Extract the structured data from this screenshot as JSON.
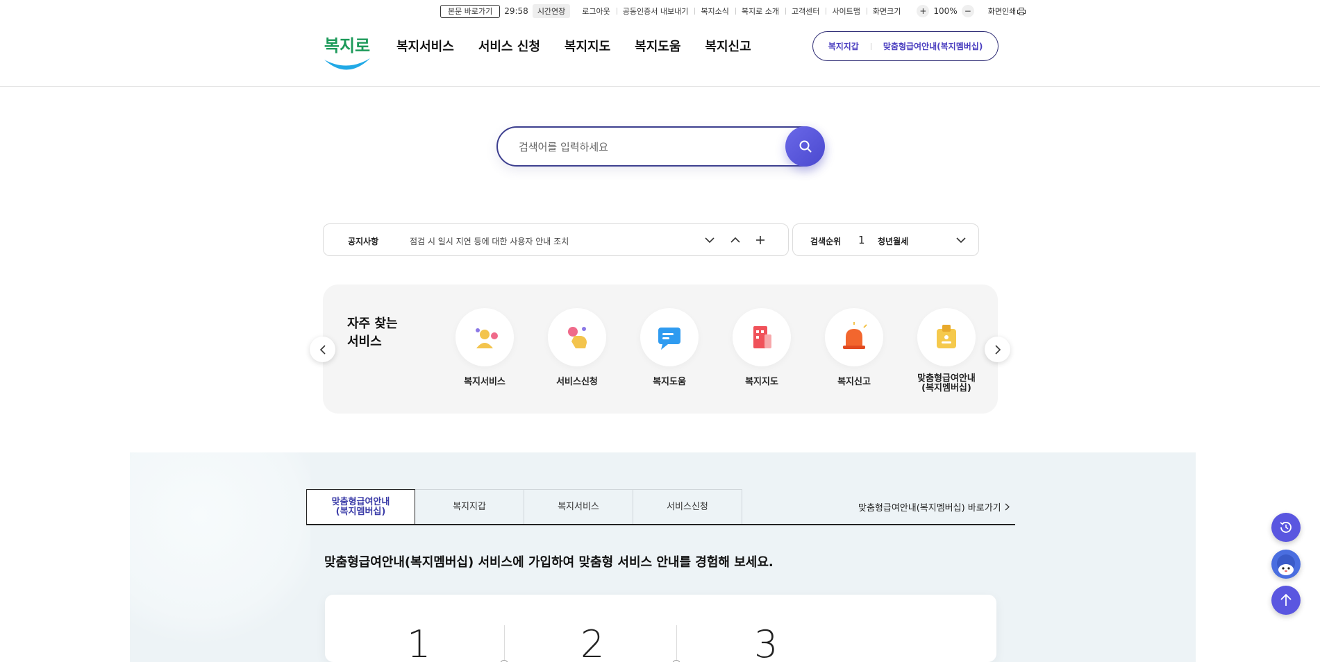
{
  "utility": {
    "skip_label": "본문 바로가기",
    "timer": "29:58",
    "extend_label": "시간연장",
    "links": [
      "로그아웃",
      "공동인증서 내보내기",
      "복지소식",
      "복지로 소개",
      "고객센터",
      "사이트맵",
      "화면크기"
    ],
    "zoom_in": "+",
    "zoom_value": "100%",
    "zoom_out": "−",
    "print_label": "화면인쇄"
  },
  "header": {
    "logo_text": "복지로",
    "nav": [
      "복지서비스",
      "서비스 신청",
      "복지지도",
      "복지도움",
      "복지신고"
    ],
    "quick_links": [
      "복지지갑",
      "맞춤형급여안내(복지멤버십)"
    ]
  },
  "search": {
    "placeholder": "검색어를 입력하세요",
    "value": ""
  },
  "notice": {
    "title": "공지사항",
    "text": "점검 시 일시 지연 등에 대한 사용자 안내 조치"
  },
  "rank": {
    "title": "검색순위",
    "number": "1",
    "keyword": "청년월세"
  },
  "frequent": {
    "title": "자주 찾는\n서비스",
    "items": [
      {
        "label": "복지서비스",
        "icon": "person-icon"
      },
      {
        "label": "서비스신청",
        "icon": "hand-click-icon"
      },
      {
        "label": "복지도움",
        "icon": "chat-bubble-icon"
      },
      {
        "label": "복지지도",
        "icon": "map-blocks-icon"
      },
      {
        "label": "복지신고",
        "icon": "alarm-siren-icon"
      },
      {
        "label": "맞춤형급여안내\n(복지멤버십)",
        "icon": "id-card-icon"
      }
    ]
  },
  "membership": {
    "tabs": [
      "맞춤형급여안내\n(복지멤버십)",
      "복지지갑",
      "복지서비스",
      "서비스신청"
    ],
    "active_tab": 0,
    "goto_label": "맞춤형급여안내(복지멤버십) 바로가기",
    "description": "맞춤형급여안내(복지멤버십) 서비스에 가입하여 맞춤형 서비스 안내를 경험해 보세요.",
    "steps": [
      "1",
      "2",
      "3"
    ]
  },
  "floating": [
    "recent-history-icon",
    "chatbot-icon",
    "scroll-top-icon"
  ],
  "colors": {
    "brand": "#4b49cf",
    "navy": "#2f2d75",
    "section_bg": "#edf3f6"
  }
}
